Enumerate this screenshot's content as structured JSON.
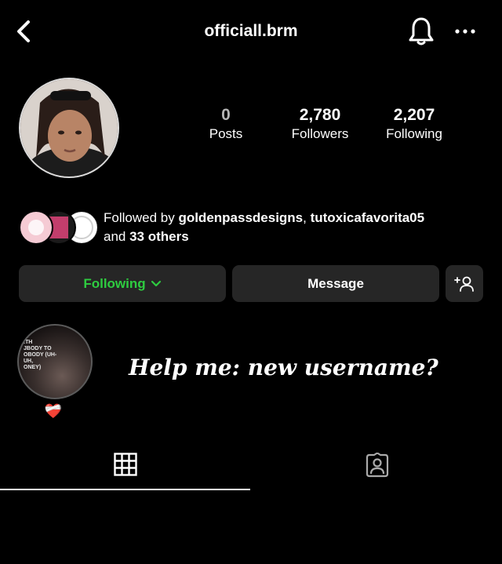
{
  "header": {
    "username": "officiall.brm",
    "icons": [
      "chevron-left-icon",
      "bell-icon",
      "more-horizontal-icon"
    ]
  },
  "profile": {
    "stats": [
      {
        "value": "0",
        "label": "Posts"
      },
      {
        "value": "2,780",
        "label": "Followers"
      },
      {
        "value": "2,207",
        "label": "Following"
      }
    ],
    "followed_by": {
      "prefix": "Followed by ",
      "user1": "goldenpassdesigns",
      "separator": ", ",
      "user2": "tutoxicafavorita05",
      "and": "and ",
      "others": "33 others"
    }
  },
  "actions": {
    "following_label": "Following",
    "message_label": "Message",
    "add_user_icon": "add-user-icon"
  },
  "note": {
    "text": "Help me: new username?",
    "emoji": "❤️‍🩹"
  },
  "highlight": {
    "text_lines": [
      ".TH",
      "JBODY TO",
      "OBODY (UH-",
      "UH,",
      "ONEY)"
    ]
  },
  "tabs": [
    "grid-icon",
    "tagged-icon"
  ],
  "colors": {
    "background": "#000000",
    "button_bg": "#262626",
    "following_green": "#2ecc40",
    "text": "#ffffff"
  }
}
